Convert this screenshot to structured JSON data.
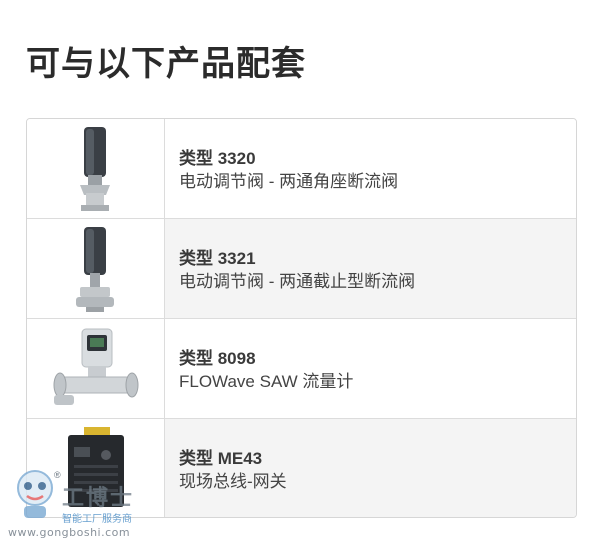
{
  "page": {
    "title": "可与以下产品配套"
  },
  "products": [
    {
      "type": "类型 3320",
      "description": "电动调节阀 - 两通角座断流阀",
      "icon": "angle-seat-valve-image"
    },
    {
      "type": "类型 3321",
      "description": "电动调节阀 - 两通截止型断流阀",
      "icon": "globe-valve-image"
    },
    {
      "type": "类型 8098",
      "description": "FLOWave SAW 流量计",
      "icon": "flowmeter-image"
    },
    {
      "type": "类型 ME43",
      "description": "现场总线-网关",
      "icon": "fieldbus-gateway-image"
    }
  ],
  "watermark": {
    "brand": "工博士",
    "subtitle": "智能工厂服务商",
    "url": "www.gongboshi.com",
    "registered": "®"
  },
  "colors": {
    "title": "#2b2b2b",
    "row_alt_bg": "#f4f4f4",
    "border": "#d6d6d6"
  }
}
